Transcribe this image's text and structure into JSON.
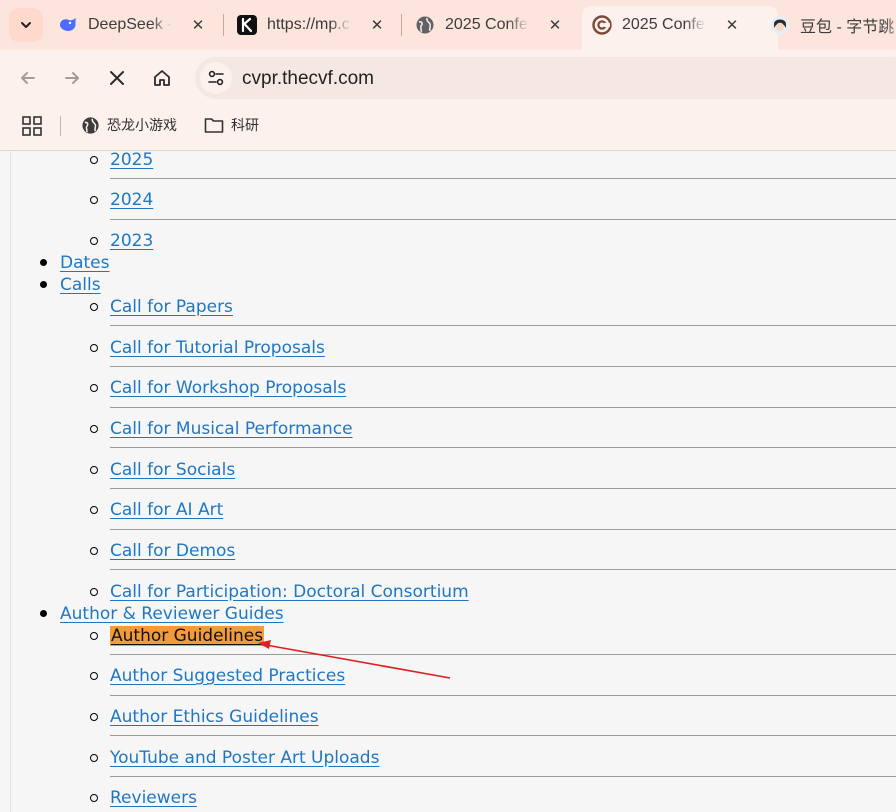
{
  "tabs": [
    {
      "title": "DeepSeek - ",
      "favicon": "deepseek-whale-icon"
    },
    {
      "title": "https://mp.c",
      "favicon": "k-logo-icon"
    },
    {
      "title": "2025 Confer",
      "favicon": "globe-icon"
    },
    {
      "title": "2025 Confer",
      "favicon": "cvpr-logo-icon",
      "active": true
    },
    {
      "title": "豆包 - 字节跳",
      "favicon": "doubao-avatar-icon"
    }
  ],
  "toolbar": {
    "url": "cvpr.thecvf.com"
  },
  "bookmarks": [
    {
      "label": "恐龙小游戏",
      "icon": "globe-icon"
    },
    {
      "label": "科研",
      "icon": "folder-icon"
    }
  ],
  "menu": {
    "years": [
      "2025",
      "2024",
      "2023"
    ],
    "dates": "Dates",
    "calls": {
      "label": "Calls",
      "items": [
        "Call for Papers",
        "Call for Tutorial Proposals",
        "Call for Workshop Proposals",
        "Call for Musical Performance",
        "Call for Socials",
        "Call for AI Art",
        "Call for Demos",
        "Call for Participation: Doctoral Consortium"
      ]
    },
    "guides": {
      "label": "Author & Reviewer Guides",
      "items": [
        "Author Guidelines",
        "Author Suggested Practices",
        "Author Ethics Guidelines",
        "YouTube and Poster Art Uploads",
        "Reviewers"
      ]
    }
  },
  "colors": {
    "link": "#1f77c4",
    "highlight": "#f39a3a",
    "annotation_arrow": "#e02020",
    "tabstrip": "#fce5dd"
  }
}
